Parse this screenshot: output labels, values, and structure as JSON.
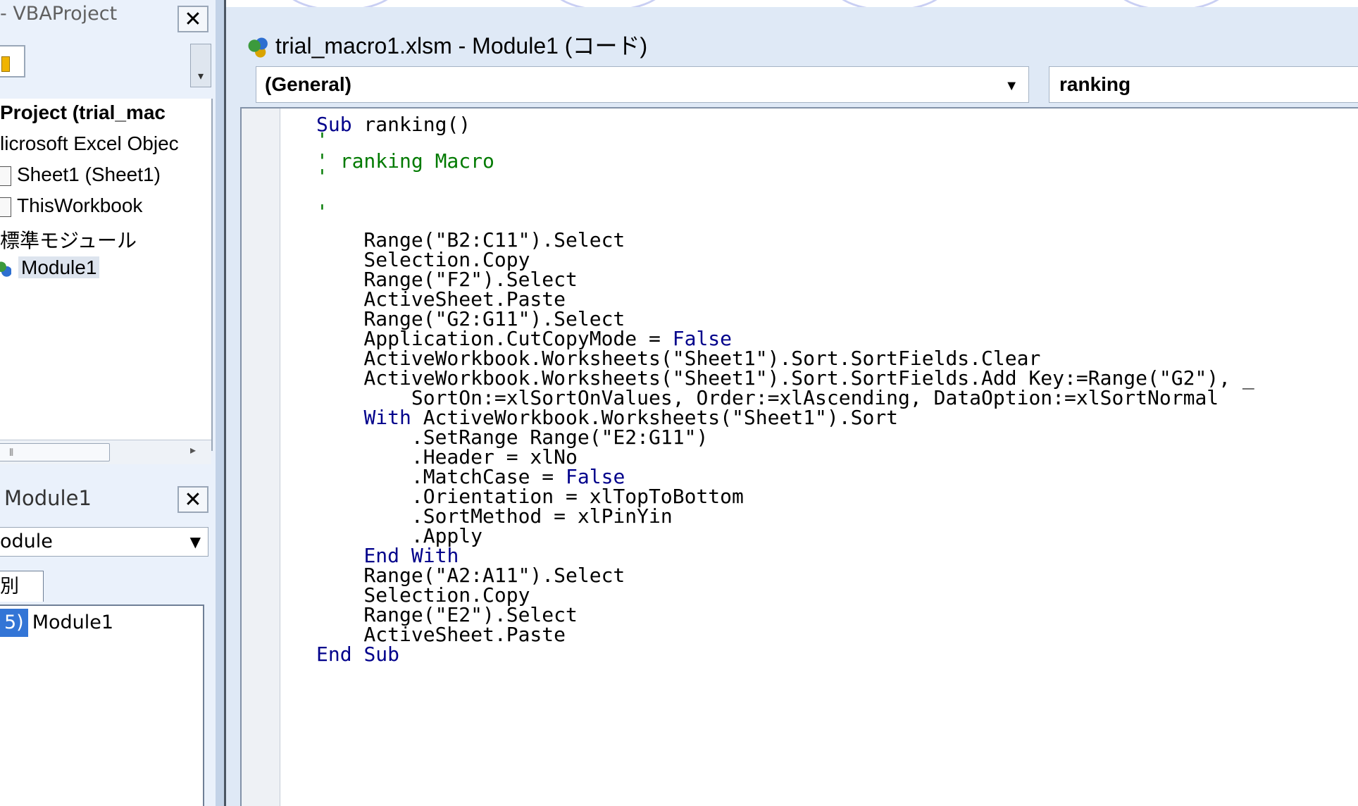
{
  "left_pane": {
    "project_title": "- VBAProject",
    "tree": [
      {
        "label": "Project (trial_mac",
        "bold": true
      },
      {
        "label": "licrosoft Excel Objec"
      },
      {
        "label": "Sheet1 (Sheet1)"
      },
      {
        "label": "ThisWorkbook"
      },
      {
        "label": "標準モジュール"
      },
      {
        "label": "Module1"
      }
    ],
    "properties_title": "Module1",
    "properties_dropdown": "odule",
    "properties_tab": "別",
    "properties_row_key": "5)",
    "properties_row_value": "Module1"
  },
  "code_window": {
    "title": "trial_macro1.xlsm - Module1 (コード)",
    "object_dropdown": "(General)",
    "procedure_dropdown": "ranking",
    "code": [
      "Sub ranking()",
      "'",
      "' ranking Macro",
      "'",
      "",
      "'",
      "",
      "    Range(\"B2:C11\").Select",
      "    Selection.Copy",
      "    Range(\"F2\").Select",
      "    ActiveSheet.Paste",
      "    Range(\"G2:G11\").Select",
      "    Application.CutCopyMode = False",
      "    ActiveWorkbook.Worksheets(\"Sheet1\").Sort.SortFields.Clear",
      "    ActiveWorkbook.Worksheets(\"Sheet1\").Sort.SortFields.Add Key:=Range(\"G2\"), _",
      "        SortOn:=xlSortOnValues, Order:=xlAscending, DataOption:=xlSortNormal",
      "    With ActiveWorkbook.Worksheets(\"Sheet1\").Sort",
      "        .SetRange Range(\"E2:G11\")",
      "        .Header = xlNo",
      "        .MatchCase = False",
      "        .Orientation = xlTopToBottom",
      "        .SortMethod = xlPinYin",
      "        .Apply",
      "    End With",
      "    Range(\"A2:A11\").Select",
      "    Selection.Copy",
      "    Range(\"E2\").Select",
      "    ActiveSheet.Paste",
      "End Sub"
    ]
  },
  "colors": {
    "keyword": "#00008b",
    "comment": "#007a00",
    "selection": "#3375d6",
    "window_bg": "#dfe9f6"
  },
  "icons": {
    "close": "close-icon",
    "dropdown": "chevron-down-icon",
    "module": "module-icon",
    "sheet": "sheet-icon"
  }
}
